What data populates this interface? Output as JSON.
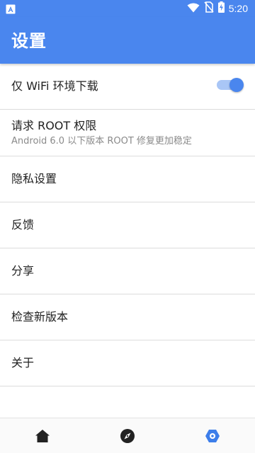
{
  "status_bar": {
    "time": "5:20",
    "left_icon": "android-a-icon",
    "right_icons": [
      "wifi-icon",
      "no-sim-icon",
      "battery-charging-icon"
    ]
  },
  "app_bar": {
    "title": "设置"
  },
  "settings": [
    {
      "label": "仅 WiFi 环境下载",
      "toggle": true,
      "toggle_on": true
    },
    {
      "label": "请求 ROOT 权限",
      "summary": "Android 6.0 以下版本 ROOT 修复更加稳定"
    },
    {
      "label": "隐私设置"
    },
    {
      "label": "反馈"
    },
    {
      "label": "分享"
    },
    {
      "label": "检查新版本"
    },
    {
      "label": "关于"
    }
  ],
  "bottom_nav": [
    {
      "icon": "home-icon",
      "active": false
    },
    {
      "icon": "compass-icon",
      "active": false
    },
    {
      "icon": "settings-hexagon-icon",
      "active": true
    }
  ],
  "colors": {
    "primary": "#4a86ee",
    "switch_track": "#a9c6f6",
    "nav_inactive": "#222222",
    "nav_active": "#3d7eea"
  }
}
